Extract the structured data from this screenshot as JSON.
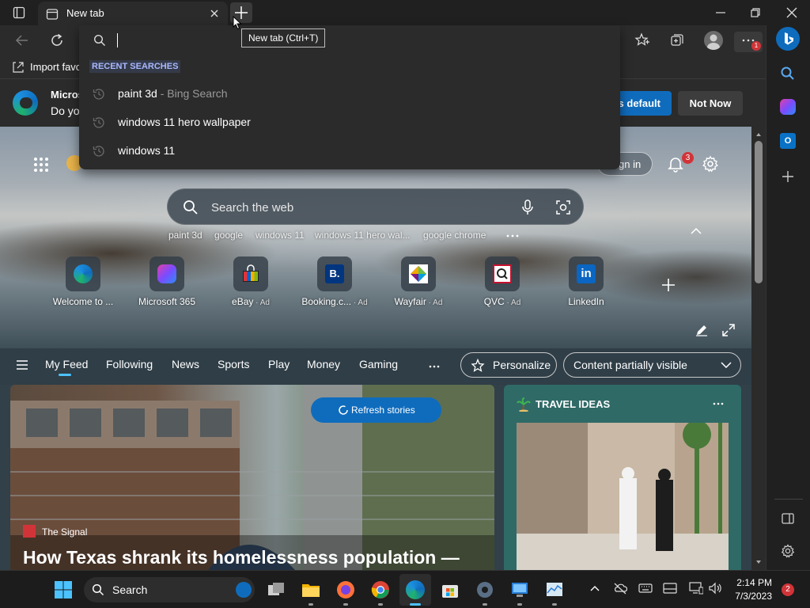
{
  "tab": {
    "title": "New tab",
    "new_tab_tooltip": "New tab (Ctrl+T)"
  },
  "bookmarks": {
    "import_label": "Import favo"
  },
  "infobar": {
    "title": "Micros",
    "text": "Do yo",
    "default_btn": "s default",
    "not_now_btn": "Not Now"
  },
  "dropdown": {
    "heading": "RECENT SEARCHES",
    "items": [
      {
        "text": "paint 3d",
        "suffix": " - Bing Search"
      },
      {
        "text": "windows 11 hero wallpaper",
        "suffix": ""
      },
      {
        "text": "windows 11",
        "suffix": ""
      }
    ]
  },
  "hero": {
    "sign_in": "gn in",
    "notifications_count": "3",
    "search_placeholder": "Search the web",
    "trending": [
      "paint 3d",
      "google",
      "windows 11",
      "windows 11 hero wal...",
      "google chrome"
    ],
    "tiles": [
      {
        "label": "Welcome to ...",
        "ad": ""
      },
      {
        "label": "Microsoft 365",
        "ad": ""
      },
      {
        "label": "eBay",
        "ad": " · Ad"
      },
      {
        "label": "Booking.c...",
        "ad": " · Ad"
      },
      {
        "label": "Wayfair",
        "ad": " · Ad"
      },
      {
        "label": "QVC",
        "ad": " · Ad"
      },
      {
        "label": "LinkedIn",
        "ad": ""
      }
    ]
  },
  "feed": {
    "tabs": [
      "My Feed",
      "Following",
      "News",
      "Sports",
      "Play",
      "Money",
      "Gaming"
    ],
    "personalize": "Personalize",
    "content_visibility": "Content partially visible",
    "refresh": "Refresh stories",
    "story_source": "The Signal",
    "story_title": "How Texas shrank its homelessness population —",
    "travel_heading": "TRAVEL IDEAS"
  },
  "sidebar": {
    "more_badge": "1"
  },
  "taskbar": {
    "search": "Search",
    "time": "2:14 PM",
    "date": "7/3/2023",
    "notif_count": "2"
  },
  "colors": {
    "accent": "#0f6cbd",
    "travel": "#2f6a67",
    "badge": "#d13438"
  }
}
